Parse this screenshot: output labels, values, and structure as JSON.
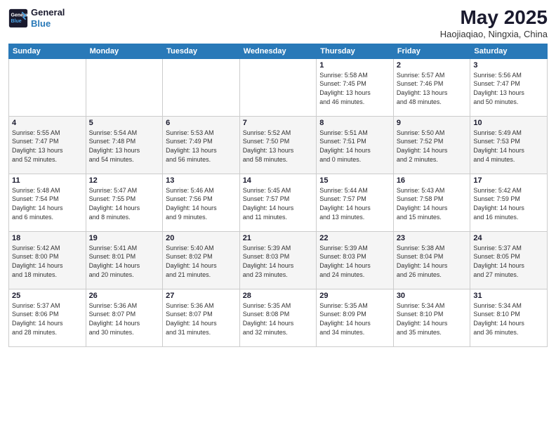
{
  "header": {
    "logo_line1": "General",
    "logo_line2": "Blue",
    "month_year": "May 2025",
    "location": "Haojiaqiao, Ningxia, China"
  },
  "weekdays": [
    "Sunday",
    "Monday",
    "Tuesday",
    "Wednesday",
    "Thursday",
    "Friday",
    "Saturday"
  ],
  "weeks": [
    [
      {
        "day": "",
        "info": ""
      },
      {
        "day": "",
        "info": ""
      },
      {
        "day": "",
        "info": ""
      },
      {
        "day": "",
        "info": ""
      },
      {
        "day": "1",
        "info": "Sunrise: 5:58 AM\nSunset: 7:45 PM\nDaylight: 13 hours\nand 46 minutes."
      },
      {
        "day": "2",
        "info": "Sunrise: 5:57 AM\nSunset: 7:46 PM\nDaylight: 13 hours\nand 48 minutes."
      },
      {
        "day": "3",
        "info": "Sunrise: 5:56 AM\nSunset: 7:47 PM\nDaylight: 13 hours\nand 50 minutes."
      }
    ],
    [
      {
        "day": "4",
        "info": "Sunrise: 5:55 AM\nSunset: 7:47 PM\nDaylight: 13 hours\nand 52 minutes."
      },
      {
        "day": "5",
        "info": "Sunrise: 5:54 AM\nSunset: 7:48 PM\nDaylight: 13 hours\nand 54 minutes."
      },
      {
        "day": "6",
        "info": "Sunrise: 5:53 AM\nSunset: 7:49 PM\nDaylight: 13 hours\nand 56 minutes."
      },
      {
        "day": "7",
        "info": "Sunrise: 5:52 AM\nSunset: 7:50 PM\nDaylight: 13 hours\nand 58 minutes."
      },
      {
        "day": "8",
        "info": "Sunrise: 5:51 AM\nSunset: 7:51 PM\nDaylight: 14 hours\nand 0 minutes."
      },
      {
        "day": "9",
        "info": "Sunrise: 5:50 AM\nSunset: 7:52 PM\nDaylight: 14 hours\nand 2 minutes."
      },
      {
        "day": "10",
        "info": "Sunrise: 5:49 AM\nSunset: 7:53 PM\nDaylight: 14 hours\nand 4 minutes."
      }
    ],
    [
      {
        "day": "11",
        "info": "Sunrise: 5:48 AM\nSunset: 7:54 PM\nDaylight: 14 hours\nand 6 minutes."
      },
      {
        "day": "12",
        "info": "Sunrise: 5:47 AM\nSunset: 7:55 PM\nDaylight: 14 hours\nand 8 minutes."
      },
      {
        "day": "13",
        "info": "Sunrise: 5:46 AM\nSunset: 7:56 PM\nDaylight: 14 hours\nand 9 minutes."
      },
      {
        "day": "14",
        "info": "Sunrise: 5:45 AM\nSunset: 7:57 PM\nDaylight: 14 hours\nand 11 minutes."
      },
      {
        "day": "15",
        "info": "Sunrise: 5:44 AM\nSunset: 7:57 PM\nDaylight: 14 hours\nand 13 minutes."
      },
      {
        "day": "16",
        "info": "Sunrise: 5:43 AM\nSunset: 7:58 PM\nDaylight: 14 hours\nand 15 minutes."
      },
      {
        "day": "17",
        "info": "Sunrise: 5:42 AM\nSunset: 7:59 PM\nDaylight: 14 hours\nand 16 minutes."
      }
    ],
    [
      {
        "day": "18",
        "info": "Sunrise: 5:42 AM\nSunset: 8:00 PM\nDaylight: 14 hours\nand 18 minutes."
      },
      {
        "day": "19",
        "info": "Sunrise: 5:41 AM\nSunset: 8:01 PM\nDaylight: 14 hours\nand 20 minutes."
      },
      {
        "day": "20",
        "info": "Sunrise: 5:40 AM\nSunset: 8:02 PM\nDaylight: 14 hours\nand 21 minutes."
      },
      {
        "day": "21",
        "info": "Sunrise: 5:39 AM\nSunset: 8:03 PM\nDaylight: 14 hours\nand 23 minutes."
      },
      {
        "day": "22",
        "info": "Sunrise: 5:39 AM\nSunset: 8:03 PM\nDaylight: 14 hours\nand 24 minutes."
      },
      {
        "day": "23",
        "info": "Sunrise: 5:38 AM\nSunset: 8:04 PM\nDaylight: 14 hours\nand 26 minutes."
      },
      {
        "day": "24",
        "info": "Sunrise: 5:37 AM\nSunset: 8:05 PM\nDaylight: 14 hours\nand 27 minutes."
      }
    ],
    [
      {
        "day": "25",
        "info": "Sunrise: 5:37 AM\nSunset: 8:06 PM\nDaylight: 14 hours\nand 28 minutes."
      },
      {
        "day": "26",
        "info": "Sunrise: 5:36 AM\nSunset: 8:07 PM\nDaylight: 14 hours\nand 30 minutes."
      },
      {
        "day": "27",
        "info": "Sunrise: 5:36 AM\nSunset: 8:07 PM\nDaylight: 14 hours\nand 31 minutes."
      },
      {
        "day": "28",
        "info": "Sunrise: 5:35 AM\nSunset: 8:08 PM\nDaylight: 14 hours\nand 32 minutes."
      },
      {
        "day": "29",
        "info": "Sunrise: 5:35 AM\nSunset: 8:09 PM\nDaylight: 14 hours\nand 34 minutes."
      },
      {
        "day": "30",
        "info": "Sunrise: 5:34 AM\nSunset: 8:10 PM\nDaylight: 14 hours\nand 35 minutes."
      },
      {
        "day": "31",
        "info": "Sunrise: 5:34 AM\nSunset: 8:10 PM\nDaylight: 14 hours\nand 36 minutes."
      }
    ]
  ]
}
